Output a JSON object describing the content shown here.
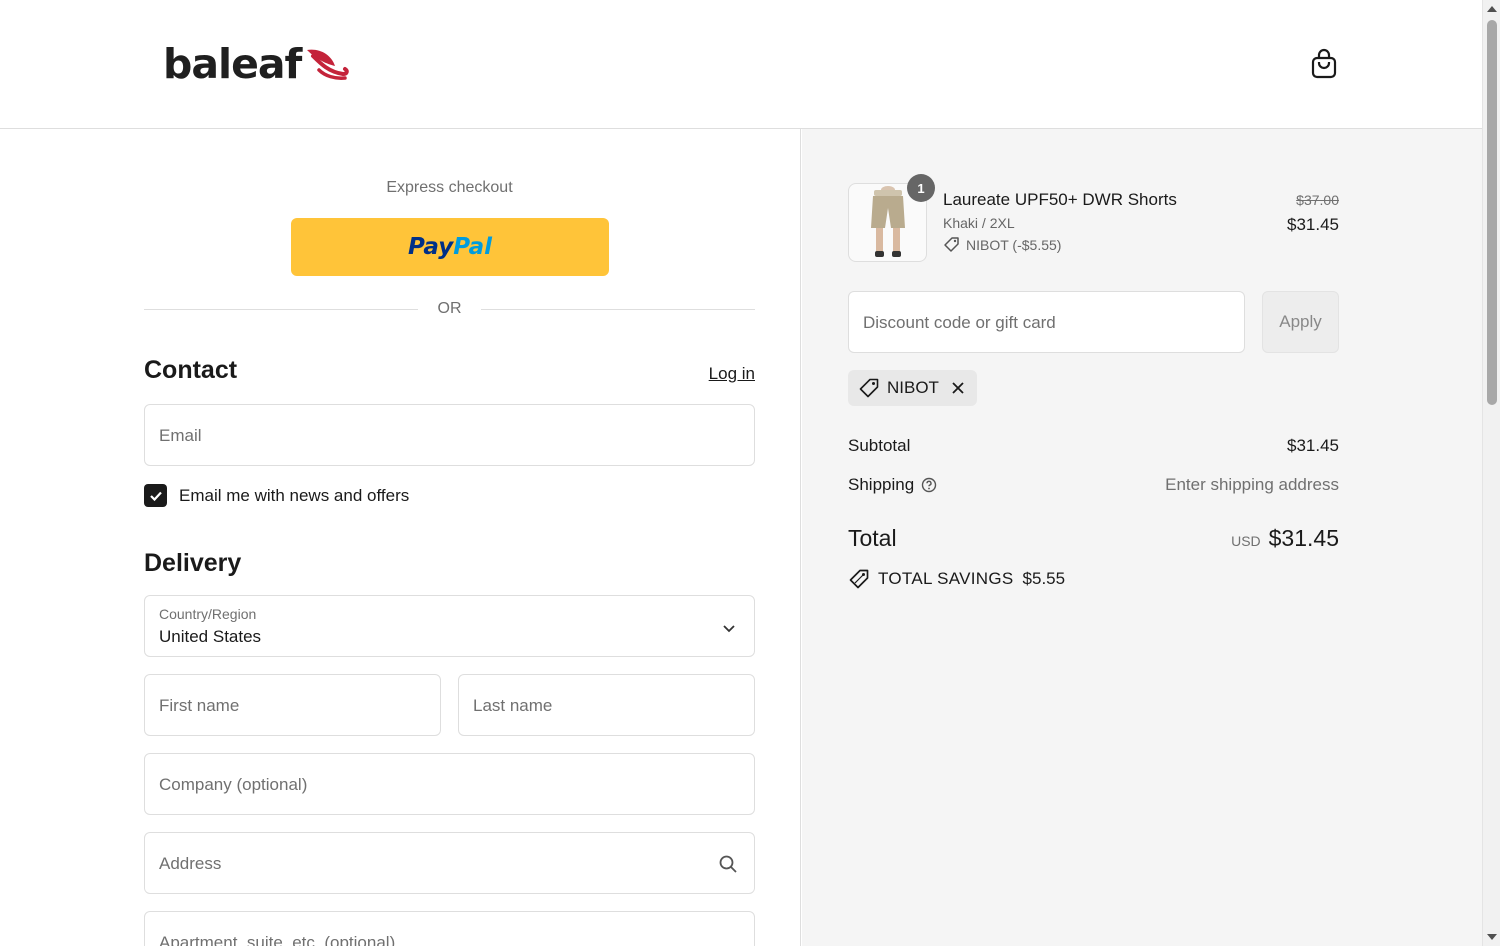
{
  "header": {
    "logo_text": "baleaf",
    "brand_color": "#c4233a",
    "cart_icon": "shopping-bag-icon"
  },
  "express": {
    "title": "Express checkout",
    "paypal_part1": "Pay",
    "paypal_part2": "Pal",
    "paypal_color": "#ffc439",
    "divider": "OR"
  },
  "contact": {
    "heading": "Contact",
    "login_link": "Log in",
    "email_placeholder": "Email",
    "newsletter_label": "Email me with news and offers",
    "newsletter_checked": true
  },
  "delivery": {
    "heading": "Delivery",
    "country_label": "Country/Region",
    "country_value": "United States",
    "first_name_placeholder": "First name",
    "last_name_placeholder": "Last name",
    "company_placeholder": "Company (optional)",
    "address_placeholder": "Address",
    "apartment_placeholder": "Apartment, suite, etc. (optional)"
  },
  "summary": {
    "item": {
      "quantity": "1",
      "name": "Laureate UPF50+ DWR Shorts",
      "variant": "Khaki / 2XL",
      "discount": "NIBOT (-$5.55)",
      "original_price": "$37.00",
      "price": "$31.45"
    },
    "discount_placeholder": "Discount code or gift card",
    "apply_label": "Apply",
    "applied_code": "NIBOT",
    "subtotal_label": "Subtotal",
    "subtotal_value": "$31.45",
    "shipping_label": "Shipping",
    "shipping_value": "Enter shipping address",
    "total_label": "Total",
    "total_currency": "USD",
    "total_value": "$31.45",
    "savings_label": "TOTAL SAVINGS",
    "savings_value": "$5.55"
  }
}
